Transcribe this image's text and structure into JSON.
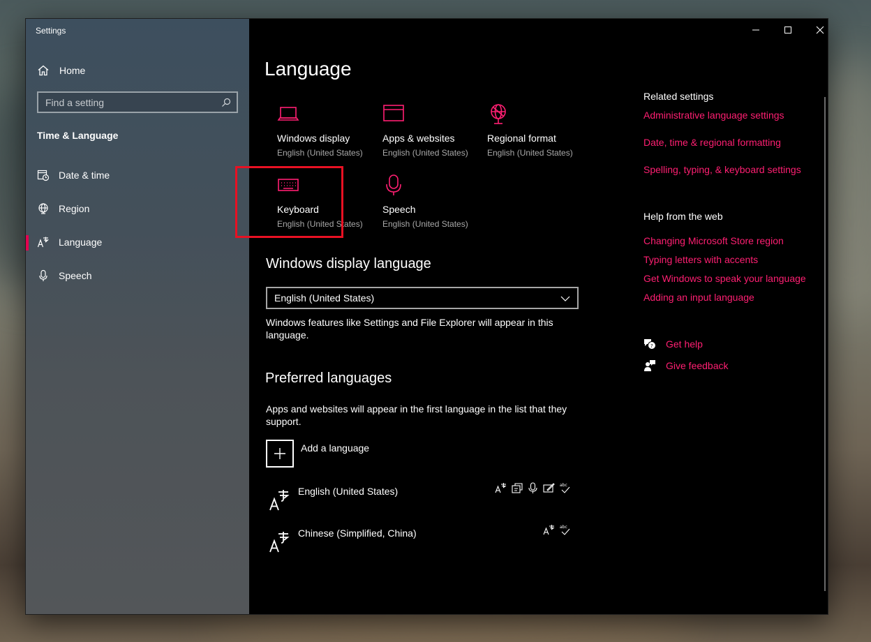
{
  "window": {
    "title": "Settings"
  },
  "sidebar": {
    "home_label": "Home",
    "search_placeholder": "Find a setting",
    "section_title": "Time & Language",
    "items": [
      {
        "label": "Date & time",
        "icon": "calendar-clock-icon"
      },
      {
        "label": "Region",
        "icon": "globe-icon"
      },
      {
        "label": "Language",
        "icon": "language-icon",
        "active": true
      },
      {
        "label": "Speech",
        "icon": "microphone-icon"
      }
    ]
  },
  "main": {
    "title": "Language",
    "tiles": [
      {
        "label": "Windows display",
        "sub": "English (United States)",
        "icon": "laptop-icon"
      },
      {
        "label": "Apps & websites",
        "sub": "English (United States)",
        "icon": "browser-window-icon"
      },
      {
        "label": "Regional format",
        "sub": "English (United States)",
        "icon": "globe-icon"
      },
      {
        "label": "Keyboard",
        "sub": "English (United States)",
        "icon": "keyboard-icon",
        "highlighted": true
      },
      {
        "label": "Speech",
        "sub": "English (United States)",
        "icon": "microphone-icon"
      }
    ],
    "display_language": {
      "heading": "Windows display language",
      "selected": "English (United States)",
      "description": "Windows features like Settings and File Explorer will appear in this language."
    },
    "preferred": {
      "heading": "Preferred languages",
      "description": "Apps and websites will appear in the first language in the list that they support.",
      "add_label": "Add a language",
      "languages": [
        {
          "name": "English (United States)",
          "features": [
            "display-language-icon",
            "text-to-speech-icon",
            "speech-recognition-icon",
            "handwriting-icon",
            "spellcheck-icon"
          ]
        },
        {
          "name": "Chinese (Simplified, China)",
          "features": [
            "display-language-icon",
            "spellcheck-icon"
          ]
        }
      ]
    }
  },
  "related": {
    "heading": "Related settings",
    "links": [
      "Administrative language settings",
      "Date, time & regional formatting",
      "Spelling, typing, & keyboard settings"
    ]
  },
  "help_web": {
    "heading": "Help from the web",
    "links": [
      "Changing Microsoft Store region",
      "Typing letters with accents",
      "Get Windows to speak your language",
      "Adding an input language"
    ]
  },
  "support": {
    "get_help": "Get help",
    "give_feedback": "Give feedback"
  },
  "colors": {
    "accent": "#ff1f72",
    "highlight_border": "#e81123"
  }
}
